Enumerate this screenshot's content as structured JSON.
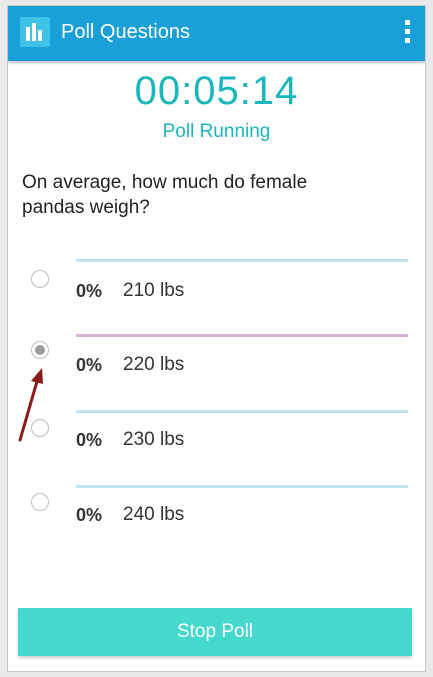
{
  "appbar": {
    "title": "Poll Questions",
    "app_icon": "bar-chart-icon",
    "menu_icon": "overflow-menu-icon"
  },
  "timer": "00:05:14",
  "status": "Poll Running",
  "question": "On average, how much do female pandas weigh?",
  "options": [
    {
      "percent": "0%",
      "label": "210 lbs",
      "selected": false,
      "line_color": "#bfe6ef"
    },
    {
      "percent": "0%",
      "label": "220 lbs",
      "selected": true,
      "line_color": "#d7b6d3"
    },
    {
      "percent": "0%",
      "label": "230 lbs",
      "selected": false,
      "line_color": "#bfe6ef"
    },
    {
      "percent": "0%",
      "label": "240 lbs",
      "selected": false,
      "line_color": "#bfe6ef"
    }
  ],
  "stop_button": "Stop Poll",
  "colors": {
    "appbar": "#1aa0d8",
    "accent": "#1bb5bd",
    "button": "#44d9cc",
    "annotation_arrow": "#8b1a1a"
  }
}
